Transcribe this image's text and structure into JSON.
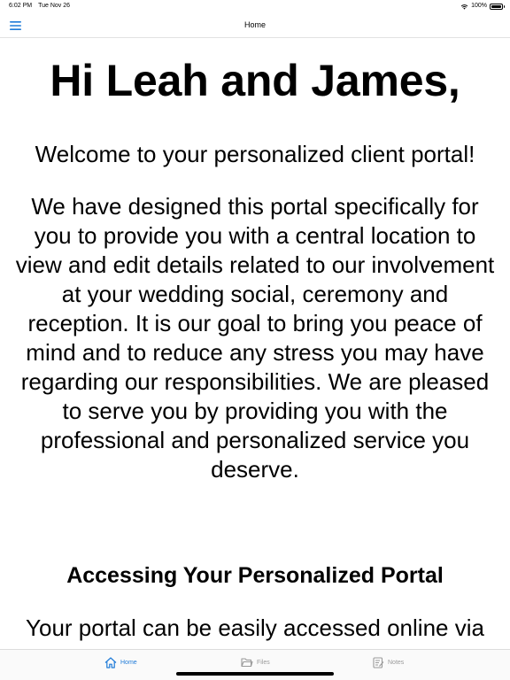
{
  "status_bar": {
    "time": "6:02 PM",
    "date": "Tue Nov 26",
    "battery": "100%"
  },
  "nav": {
    "title": "Home",
    "menu_icon": "hamburger-menu-icon"
  },
  "content": {
    "greeting": "Hi Leah and James,",
    "welcome": "Welcome to your personalized client portal!",
    "intro": "We have designed this portal specifically for you to provide you with a central location to view and edit details related to our involvement at your wedding social, ceremony and reception. It is our goal to bring you peace of mind and to reduce any stress you may have regarding our responsibilities. We are pleased to serve you by providing you with the professional and personalized service you deserve.",
    "section_heading": "Accessing Your Personalized Portal",
    "access_text": "Your portal can be easily accessed online via"
  },
  "tabs": [
    {
      "label": "Home",
      "icon": "house-icon",
      "active": true
    },
    {
      "label": "Files",
      "icon": "folder-icon",
      "active": false
    },
    {
      "label": "Notes",
      "icon": "notes-icon",
      "active": false
    }
  ],
  "colors": {
    "accent": "#1f7bd8",
    "inactive": "#9a9a9a",
    "text": "#000000",
    "background": "#ffffff"
  }
}
